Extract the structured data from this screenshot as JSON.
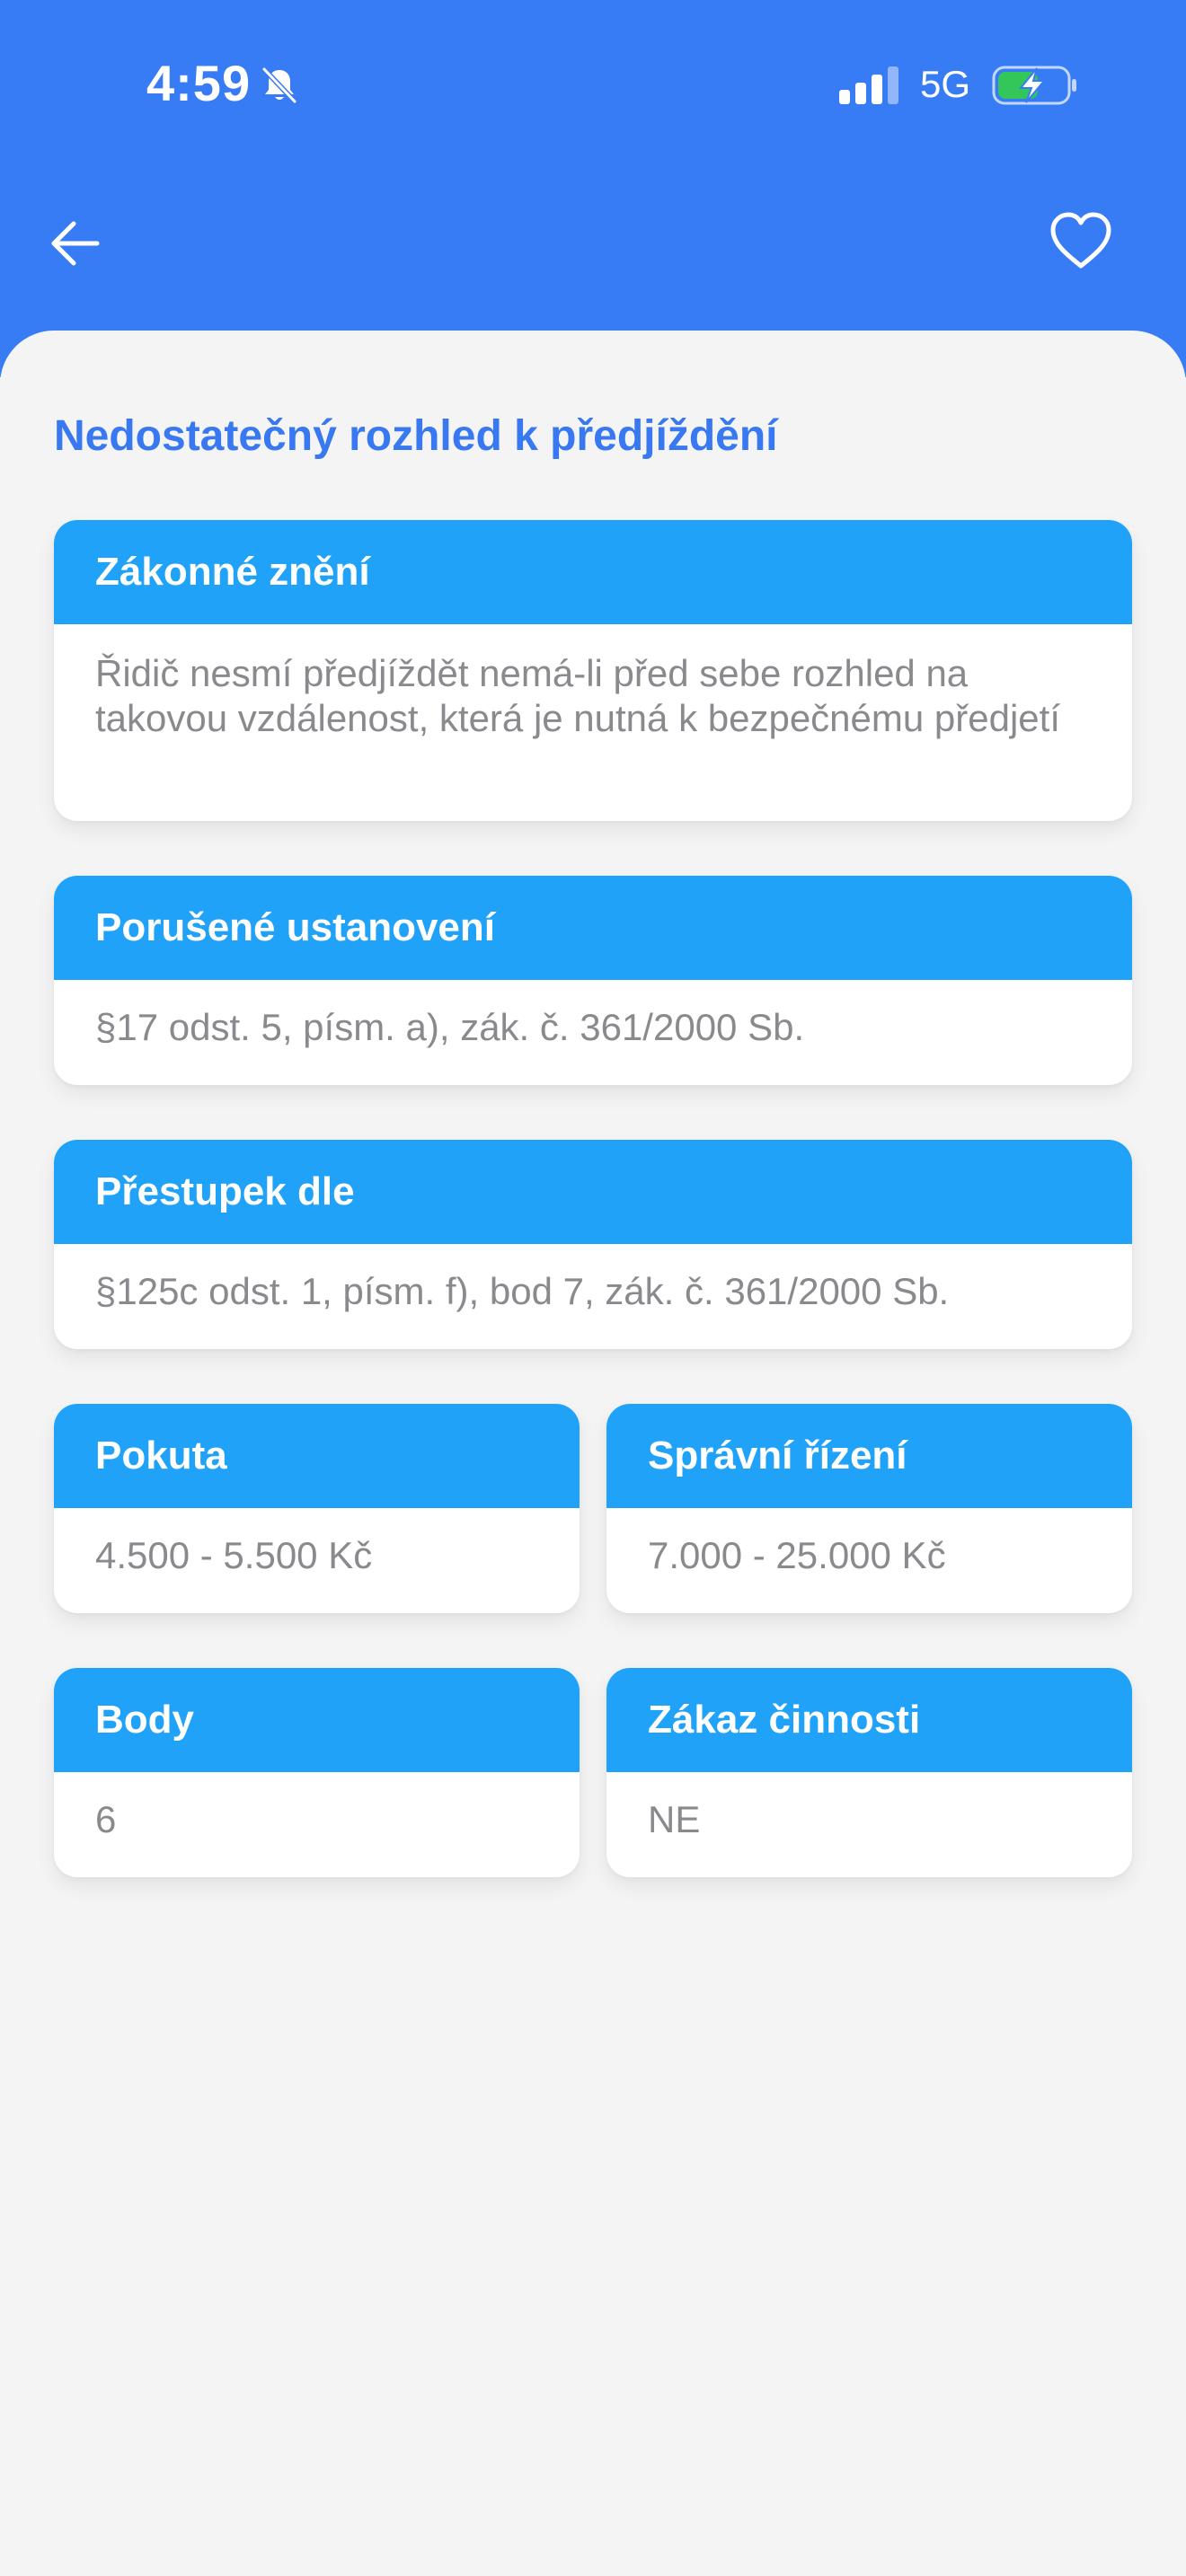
{
  "status_bar": {
    "time": "4:59",
    "network": "5G"
  },
  "colors": {
    "header_blue": "#377bf5",
    "card_header_blue": "#20a2f8",
    "title_blue": "#3878f0",
    "background": "#f4f4f5",
    "body_text": "#8a8a8e",
    "battery_green": "#33c759"
  },
  "icons": {
    "back": "arrow-left-icon",
    "favorite": "heart-outline-icon",
    "silent": "bell-slash-icon",
    "signal": "cellular-signal-icon",
    "battery": "battery-charging-icon"
  },
  "page": {
    "title": "Nedostatečný rozhled k předjíždění"
  },
  "cards": {
    "legal_text": {
      "title": "Zákonné znění",
      "value": "Řidič nesmí předjíždět nemá-li před sebe rozhled na takovou vzdálenost, která je nutná k bezpečnému předjetí"
    },
    "violated_provision": {
      "title": "Porušené ustanovení",
      "value": "§17 odst. 5, písm. a), zák. č. 361/2000 Sb."
    },
    "offense_by": {
      "title": "Přestupek dle",
      "value": "§125c odst. 1, písm. f), bod 7, zák. č. 361/2000 Sb."
    },
    "fine": {
      "title": "Pokuta",
      "value": "4.500 - 5.500 Kč"
    },
    "administrative_proceedings": {
      "title": "Správní řízení",
      "value": "7.000 - 25.000 Kč"
    },
    "points": {
      "title": "Body",
      "value": "6"
    },
    "driving_ban": {
      "title": "Zákaz činnosti",
      "value": "NE"
    }
  }
}
